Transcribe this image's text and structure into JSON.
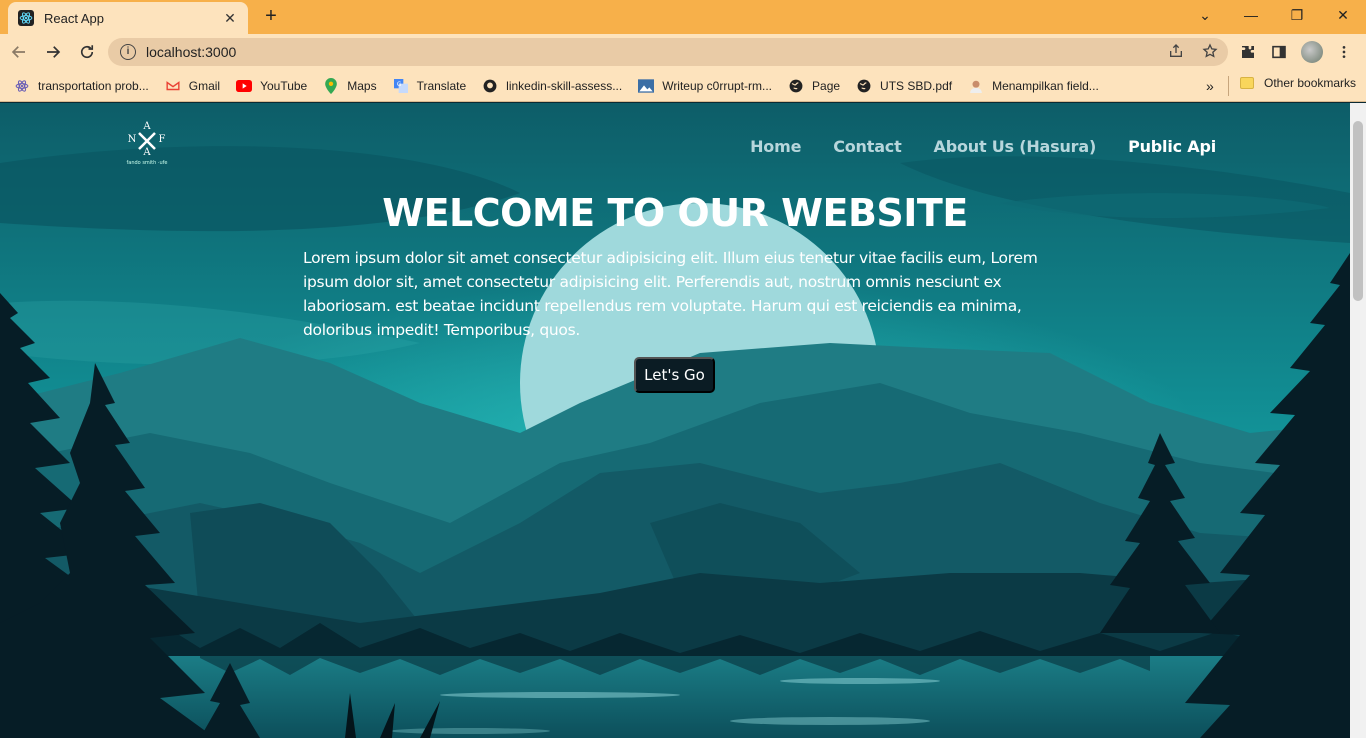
{
  "browser": {
    "tab_title": "React App",
    "tab_close": "✕",
    "new_tab": "+",
    "url": "localhost:3000",
    "window_controls": {
      "minimize": "—",
      "restore": "❐",
      "close": "✕",
      "tab_search": "⌄"
    },
    "bookmarks": [
      {
        "label": "transportation prob...",
        "icon": "react-icon",
        "color": "#6b5fb5"
      },
      {
        "label": "Gmail",
        "icon": "gmail-icon",
        "color": "#ea4335"
      },
      {
        "label": "YouTube",
        "icon": "youtube-icon",
        "color": "#ff0000"
      },
      {
        "label": "Maps",
        "icon": "maps-icon",
        "color": "#34a853"
      },
      {
        "label": "Translate",
        "icon": "translate-icon",
        "color": "#4285f4"
      },
      {
        "label": "linkedin-skill-assess...",
        "icon": "github-icon",
        "color": "#222222"
      },
      {
        "label": "Writeup c0rrupt-rm...",
        "icon": "image-icon",
        "color": "#3b6ea5"
      },
      {
        "label": "Page",
        "icon": "globe-icon",
        "color": "#222222"
      },
      {
        "label": "UTS SBD.pdf",
        "icon": "globe-icon",
        "color": "#222222"
      },
      {
        "label": "Menampilkan field...",
        "icon": "person-icon",
        "color": "#c98d6b"
      }
    ],
    "bookmarks_more": "»",
    "other_bookmarks": "Other bookmarks"
  },
  "site": {
    "logo_letters": {
      "top": "A",
      "left": "N",
      "right": "F",
      "bottom": "A"
    },
    "logo_caption": "fando smith ·ufe",
    "nav": [
      {
        "label": "Home",
        "active": false
      },
      {
        "label": "Contact",
        "active": false
      },
      {
        "label": "About Us (Hasura)",
        "active": false
      },
      {
        "label": "Public Api",
        "active": true
      }
    ],
    "hero_title": "WELCOME TO OUR WEBSITE",
    "hero_text": "Lorem ipsum dolor sit amet consectetur adipisicing elit. Illum eius tenetur vitae facilis eum, Lorem ipsum dolor sit, amet consectetur adipisicing elit. Perferendis aut, nostrum omnis nesciunt ex laboriosam. est beatae incidunt repellendus rem voluptate. Harum qui est reiciendis ea minima, doloribus impedit! Temporibus, quos.",
    "cta_label": "Let's Go"
  },
  "colors": {
    "tabstrip": "#f7b04a",
    "toolbar": "#fde3bd",
    "sky_top": "#0d5d68",
    "sky_bottom": "#12959a",
    "moon": "#9fd9dc",
    "mountain_far": "#1f7c84",
    "mountain_mid": "#135a66",
    "mountain_near": "#0b3a45",
    "forest": "#061d26",
    "button": "#0b1c24"
  }
}
